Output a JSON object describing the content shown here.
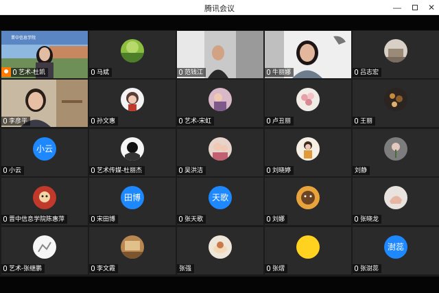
{
  "window": {
    "title": "腾讯会议"
  },
  "colors": {
    "active_speaker": "#2fbf5a",
    "text_avatar": "#1e88ff",
    "host_badge": "#ff7a00"
  },
  "participants": [
    {
      "name": "艺术-杜凯",
      "icon": "video-female-host"
    },
    {
      "name": "马斌",
      "icon": "avatar-green-landscape"
    },
    {
      "name": "范钱江",
      "icon": "video-male"
    },
    {
      "name": "牛丽娜",
      "icon": "video-female"
    },
    {
      "name": "吕志宏",
      "icon": "avatar-building"
    },
    {
      "name": "李彦平",
      "icon": "video-female-glasses"
    },
    {
      "name": "孙文惠",
      "icon": "avatar-cartoon"
    },
    {
      "name": "艺术-宋虹",
      "icon": "avatar-photo"
    },
    {
      "name": "卢丑丽",
      "icon": "avatar-flowers"
    },
    {
      "name": "王丽",
      "icon": "avatar-dark"
    },
    {
      "name": "小云",
      "avatar_text": "小云"
    },
    {
      "name": "艺术传媒-杜丽杰",
      "icon": "avatar-black-white"
    },
    {
      "name": "吴洪洁",
      "icon": "avatar-child"
    },
    {
      "name": "刘晓婷",
      "icon": "avatar-cartoon-girl"
    },
    {
      "name": "刘静",
      "icon": "avatar-flower-gray"
    },
    {
      "name": "晋中信息学院陈惠萍",
      "icon": "avatar-illustration"
    },
    {
      "name": "宋田博",
      "avatar_text": "田博"
    },
    {
      "name": "张天歌",
      "avatar_text": "天歌"
    },
    {
      "name": "刘娜",
      "icon": "avatar-bear"
    },
    {
      "name": "张晓龙",
      "icon": "avatar-hand"
    },
    {
      "name": "艺术-张继鹏",
      "icon": "avatar-sketch"
    },
    {
      "name": "李文霞",
      "icon": "avatar-room"
    },
    {
      "name": "张强",
      "icon": "avatar-cake"
    },
    {
      "name": "张熠",
      "icon": "avatar-yellow"
    },
    {
      "name": "张澍蕊",
      "avatar_text": "澍蕊"
    }
  ]
}
